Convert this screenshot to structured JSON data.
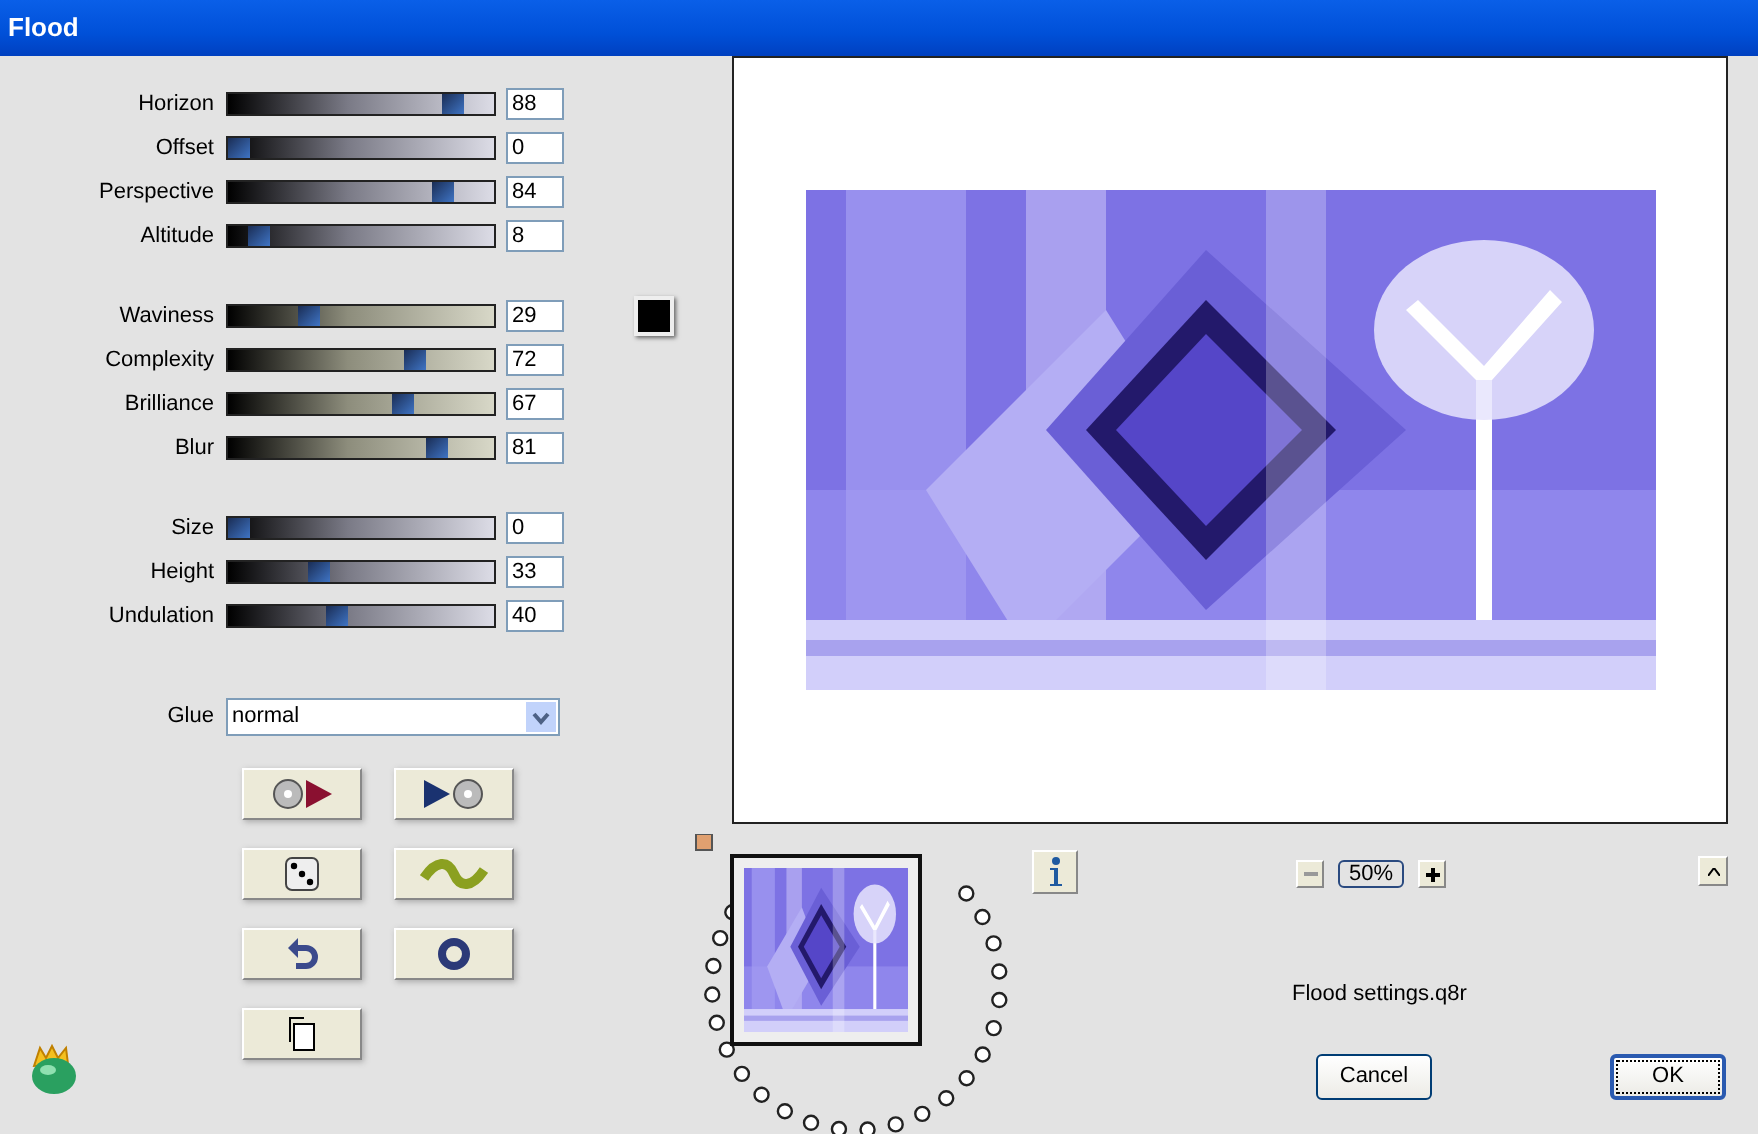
{
  "window": {
    "title": "Flood"
  },
  "slider_groups": [
    {
      "sliders": [
        {
          "label": "Horizon",
          "value": "88",
          "level": 0.88
        },
        {
          "label": "Offset",
          "value": "0",
          "level": 0
        },
        {
          "label": "Perspective",
          "value": "84",
          "level": 0.84
        },
        {
          "label": "Altitude",
          "value": "8",
          "level": 0.08
        }
      ]
    },
    {
      "sliders": [
        {
          "label": "Waviness",
          "value": "29",
          "level": 0.29
        },
        {
          "label": "Complexity",
          "value": "72",
          "level": 0.72
        },
        {
          "label": "Brilliance",
          "value": "67",
          "level": 0.67
        },
        {
          "label": "Blur",
          "value": "81",
          "level": 0.81
        }
      ]
    },
    {
      "sliders": [
        {
          "label": "Size",
          "value": "0",
          "level": 0
        },
        {
          "label": "Height",
          "value": "33",
          "level": 0.33
        },
        {
          "label": "Undulation",
          "value": "40",
          "level": 0.4
        }
      ]
    }
  ],
  "color_swatch": {
    "color": "#000000"
  },
  "glue": {
    "label": "Glue",
    "value": "normal"
  },
  "zoom": {
    "value": "50%"
  },
  "settings_file": "Flood settings.q8r",
  "buttons": [
    {
      "label": "Cancel",
      "default": false
    },
    {
      "label": "OK",
      "default": true
    }
  ]
}
